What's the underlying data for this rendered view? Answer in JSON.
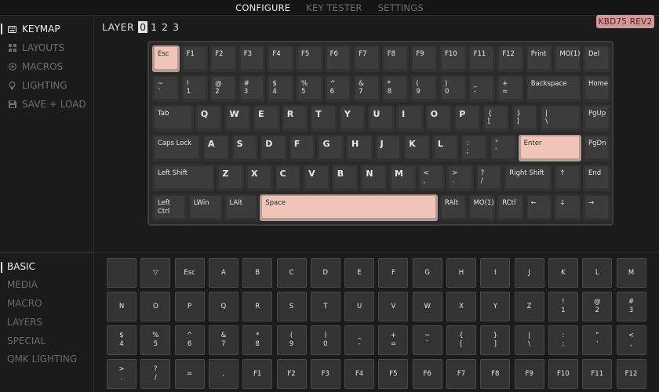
{
  "nav": {
    "tabs": [
      {
        "label": "CONFIGURE",
        "active": true
      },
      {
        "label": "KEY TESTER",
        "active": false
      },
      {
        "label": "SETTINGS",
        "active": false
      }
    ]
  },
  "sidebar": {
    "items": [
      {
        "label": "KEYMAP",
        "icon": "keyboard-icon",
        "active": true
      },
      {
        "label": "LAYOUTS",
        "icon": "grid-icon",
        "active": false
      },
      {
        "label": "MACROS",
        "icon": "circle-dot-icon",
        "active": false
      },
      {
        "label": "LIGHTING",
        "icon": "bulb-icon",
        "active": false
      },
      {
        "label": "SAVE + LOAD",
        "icon": "floppy-icon",
        "active": false
      }
    ]
  },
  "layer": {
    "label": "LAYER",
    "options": [
      "0",
      "1",
      "2",
      "3"
    ],
    "active": 0
  },
  "device": {
    "name": "KBD75 REV2"
  },
  "keyboard": {
    "rows": [
      [
        {
          "l": "Esc",
          "sel": true
        },
        {
          "l": "F1"
        },
        {
          "l": "F2"
        },
        {
          "l": "F3"
        },
        {
          "l": "F4"
        },
        {
          "l": "F5"
        },
        {
          "l": "F6"
        },
        {
          "l": "F7"
        },
        {
          "l": "F8"
        },
        {
          "l": "F9"
        },
        {
          "l": "F10"
        },
        {
          "l": "F11"
        },
        {
          "l": "F12"
        },
        {
          "l": "Print"
        },
        {
          "l": "MO(1)"
        },
        {
          "l": "Del"
        }
      ],
      [
        {
          "t": "~",
          "b": "`"
        },
        {
          "t": "!",
          "b": "1"
        },
        {
          "t": "@",
          "b": "2"
        },
        {
          "t": "#",
          "b": "3"
        },
        {
          "t": "$",
          "b": "4"
        },
        {
          "t": "%",
          "b": "5"
        },
        {
          "t": "^",
          "b": "6"
        },
        {
          "t": "&",
          "b": "7"
        },
        {
          "t": "*",
          "b": "8"
        },
        {
          "t": "(",
          "b": "9"
        },
        {
          "t": ")",
          "b": "0"
        },
        {
          "t": "_",
          "b": "-"
        },
        {
          "t": "+",
          "b": "="
        },
        {
          "l": "Backspace",
          "w": 2
        },
        {
          "l": "Home"
        }
      ],
      [
        {
          "l": "Tab",
          "w": 1.5
        },
        {
          "k": "Q"
        },
        {
          "k": "W"
        },
        {
          "k": "E"
        },
        {
          "k": "R"
        },
        {
          "k": "T"
        },
        {
          "k": "Y"
        },
        {
          "k": "U"
        },
        {
          "k": "I"
        },
        {
          "k": "O"
        },
        {
          "k": "P"
        },
        {
          "t": "{",
          "b": "["
        },
        {
          "t": "}",
          "b": "]"
        },
        {
          "t": "|",
          "b": "\\",
          "w": 1.5
        },
        {
          "l": "PgUp"
        }
      ],
      [
        {
          "l": "Caps Lock",
          "w": 1.75
        },
        {
          "k": "A"
        },
        {
          "k": "S"
        },
        {
          "k": "D"
        },
        {
          "k": "F"
        },
        {
          "k": "G"
        },
        {
          "k": "H"
        },
        {
          "k": "J"
        },
        {
          "k": "K"
        },
        {
          "k": "L"
        },
        {
          "t": ":",
          "b": ";"
        },
        {
          "t": "\"",
          "b": "'"
        },
        {
          "l": "Enter",
          "w": 2.25,
          "sel": true
        },
        {
          "l": "PgDn"
        }
      ],
      [
        {
          "l": "Left Shift",
          "w": 2.25
        },
        {
          "k": "Z"
        },
        {
          "k": "X"
        },
        {
          "k": "C"
        },
        {
          "k": "V"
        },
        {
          "k": "B"
        },
        {
          "k": "N"
        },
        {
          "k": "M"
        },
        {
          "t": "<",
          "b": ","
        },
        {
          "t": ">",
          "b": "."
        },
        {
          "t": "?",
          "b": "/"
        },
        {
          "l": "Right Shift",
          "w": 1.75
        },
        {
          "l": "↑"
        },
        {
          "l": "End"
        }
      ],
      [
        {
          "l": "Left Ctrl",
          "w": 1.25
        },
        {
          "l": "LWin",
          "w": 1.25
        },
        {
          "l": "LAlt",
          "w": 1.25
        },
        {
          "l": "Space",
          "w": 6.25,
          "sel": true
        },
        {
          "l": "RAlt"
        },
        {
          "l": "MO(1)"
        },
        {
          "l": "RCtl"
        },
        {
          "l": "←"
        },
        {
          "l": "↓"
        },
        {
          "l": "→"
        }
      ]
    ]
  },
  "categories": {
    "items": [
      {
        "label": "BASIC",
        "active": true
      },
      {
        "label": "MEDIA",
        "active": false
      },
      {
        "label": "MACRO",
        "active": false
      },
      {
        "label": "LAYERS",
        "active": false
      },
      {
        "label": "SPECIAL",
        "active": false
      },
      {
        "label": "QMK LIGHTING",
        "active": false
      }
    ]
  },
  "palette": {
    "rows": [
      [
        {
          "l": ""
        },
        {
          "l": "▽"
        },
        {
          "l": "Esc"
        },
        {
          "l": "A"
        },
        {
          "l": "B"
        },
        {
          "l": "C"
        },
        {
          "l": "D"
        },
        {
          "l": "E"
        },
        {
          "l": "F"
        },
        {
          "l": "G"
        },
        {
          "l": "H"
        },
        {
          "l": "I"
        },
        {
          "l": "J"
        },
        {
          "l": "K"
        },
        {
          "l": "L"
        },
        {
          "l": "M"
        }
      ],
      [
        {
          "l": "N"
        },
        {
          "l": "O"
        },
        {
          "l": "P"
        },
        {
          "l": "Q"
        },
        {
          "l": "R"
        },
        {
          "l": "S"
        },
        {
          "l": "T"
        },
        {
          "l": "U"
        },
        {
          "l": "V"
        },
        {
          "l": "W"
        },
        {
          "l": "X"
        },
        {
          "l": "Y"
        },
        {
          "l": "Z"
        },
        {
          "t": "!",
          "b": "1"
        },
        {
          "t": "@",
          "b": "2"
        },
        {
          "t": "#",
          "b": "3"
        }
      ],
      [
        {
          "t": "$",
          "b": "4"
        },
        {
          "t": "%",
          "b": "5"
        },
        {
          "t": "^",
          "b": "6"
        },
        {
          "t": "&",
          "b": "7"
        },
        {
          "t": "*",
          "b": "8"
        },
        {
          "t": "(",
          "b": "9"
        },
        {
          "t": ")",
          "b": "0"
        },
        {
          "t": "_",
          "b": "-"
        },
        {
          "t": "+",
          "b": "="
        },
        {
          "t": "~",
          "b": "`"
        },
        {
          "t": "{",
          "b": "["
        },
        {
          "t": "}",
          "b": "]"
        },
        {
          "t": "|",
          "b": "\\"
        },
        {
          "t": ":",
          "b": ";"
        },
        {
          "t": "\"",
          "b": "'"
        },
        {
          "t": "<",
          "b": ","
        }
      ],
      [
        {
          "t": ">",
          "b": "."
        },
        {
          "t": "?",
          "b": "/"
        },
        {
          "l": "="
        },
        {
          "l": ","
        },
        {
          "l": "F1"
        },
        {
          "l": "F2"
        },
        {
          "l": "F3"
        },
        {
          "l": "F4"
        },
        {
          "l": "F5"
        },
        {
          "l": "F6"
        },
        {
          "l": "F7"
        },
        {
          "l": "F8"
        },
        {
          "l": "F9"
        },
        {
          "l": "F10"
        },
        {
          "l": "F11"
        },
        {
          "l": "F12"
        }
      ]
    ]
  }
}
